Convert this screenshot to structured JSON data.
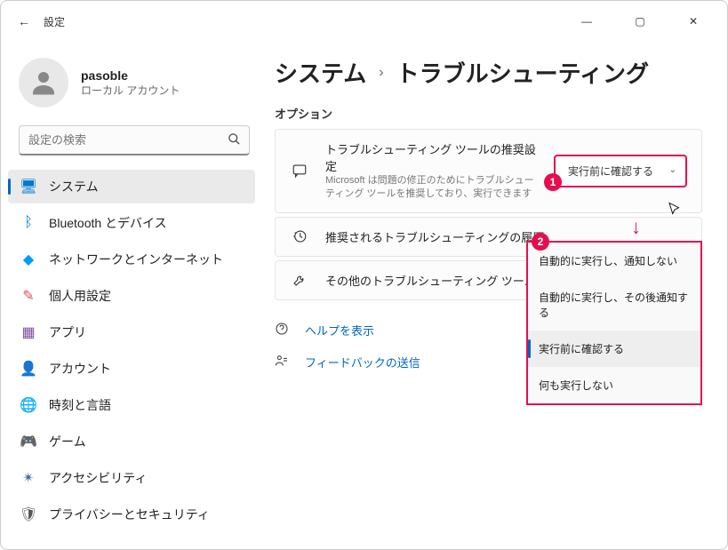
{
  "window": {
    "title": "設定"
  },
  "user": {
    "name": "pasoble",
    "subtitle": "ローカル アカウント"
  },
  "search": {
    "placeholder": "設定の検索"
  },
  "nav": [
    {
      "key": "system",
      "label": "システム",
      "icon": "🖥",
      "active": true
    },
    {
      "key": "bluetooth",
      "label": "Bluetooth とデバイス",
      "icon": "ᛒ"
    },
    {
      "key": "network",
      "label": "ネットワークとインターネット",
      "icon": "◆"
    },
    {
      "key": "personalization",
      "label": "個人用設定",
      "icon": "✎"
    },
    {
      "key": "apps",
      "label": "アプリ",
      "icon": "▦"
    },
    {
      "key": "accounts",
      "label": "アカウント",
      "icon": "👤"
    },
    {
      "key": "time",
      "label": "時刻と言語",
      "icon": "🌐"
    },
    {
      "key": "gaming",
      "label": "ゲーム",
      "icon": "🎮"
    },
    {
      "key": "accessibility",
      "label": "アクセシビリティ",
      "icon": "✴"
    },
    {
      "key": "privacy",
      "label": "プライバシーとセキュリティ",
      "icon": "🛡"
    }
  ],
  "breadcrumb": {
    "root": "システム",
    "page": "トラブルシューティング"
  },
  "section": {
    "label": "オプション"
  },
  "cards": {
    "recommended": {
      "title": "トラブルシューティング ツールの推奨設定",
      "subtitle": "Microsoft は問題の修正のためにトラブルシューティング ツールを推奨しており、実行できます",
      "dropdown_value": "実行前に確認する"
    },
    "history": {
      "title": "推奨されるトラブルシューティングの履歴"
    },
    "other": {
      "title": "その他のトラブルシューティング ツール"
    }
  },
  "menu_options": [
    {
      "label": "自動的に実行し、通知しない"
    },
    {
      "label": "自動的に実行し、その後通知する"
    },
    {
      "label": "実行前に確認する",
      "selected": true
    },
    {
      "label": "何も実行しない"
    }
  ],
  "links": {
    "help": "ヘルプを表示",
    "feedback": "フィードバックの送信"
  },
  "callouts": {
    "one": "1",
    "two": "2"
  }
}
